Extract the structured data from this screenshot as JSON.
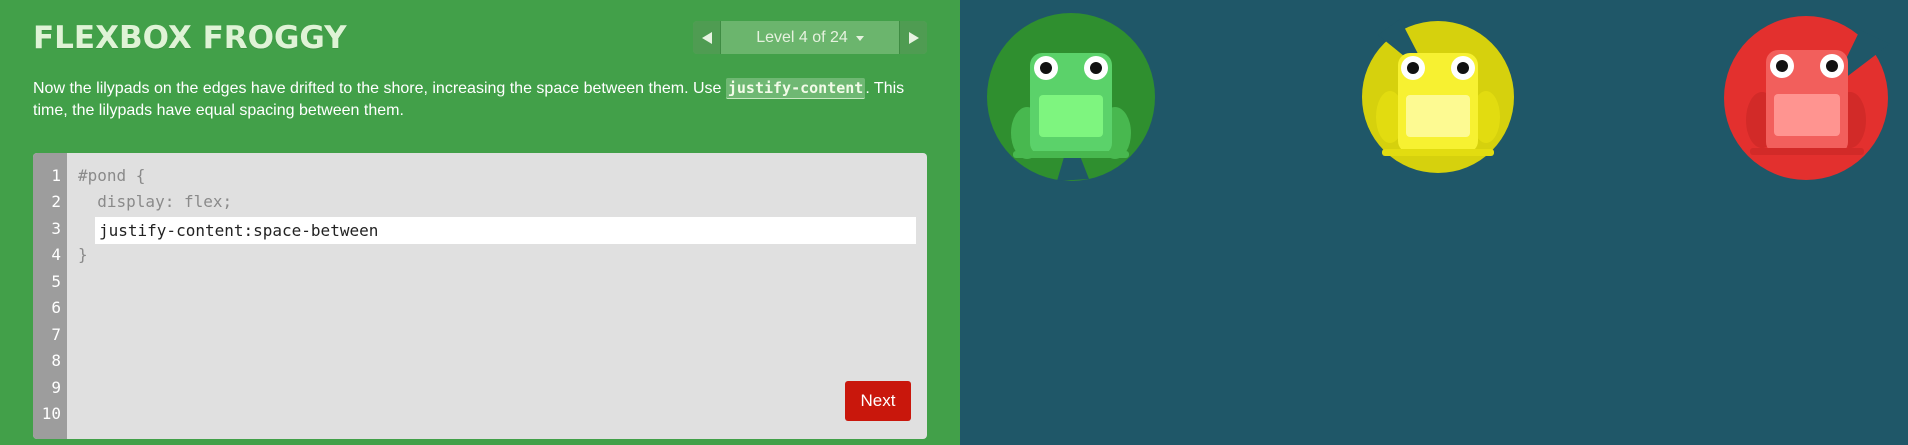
{
  "app": {
    "title": "FLEXBOX FROGGY"
  },
  "level_nav": {
    "label": "Level 4 of 24",
    "current": 4,
    "total": 24
  },
  "instructions": {
    "before": "Now the lilypads on the edges have drifted to the shore, increasing the space between them. Use ",
    "code": "justify-content",
    "after": ". This time, the lilypads have equal spacing between them."
  },
  "editor": {
    "line_numbers": [
      "1",
      "2",
      "3",
      "4",
      "5",
      "6",
      "7",
      "8",
      "9",
      "10"
    ],
    "line1": "#pond {",
    "line2": "  display: flex;",
    "input_value": "justify-content:space-between",
    "line4": "}",
    "next_label": "Next"
  },
  "colors": {
    "sidebar": "#42a049",
    "pond": "#1f5768",
    "next_button": "#c9170c",
    "frog_green": "#5bd26a",
    "frog_yellow": "#f7f131",
    "frog_red": "#f25f5c",
    "pad_green": "#2f8f2f",
    "pad_yellow": "#d6d10d",
    "pad_red": "#e3302e"
  },
  "icons": {
    "prev": "triangle-left-icon",
    "next": "triangle-right-icon",
    "dropdown": "caret-down-icon"
  },
  "pond": {
    "frogs": [
      {
        "color": "green"
      },
      {
        "color": "yellow"
      },
      {
        "color": "red"
      }
    ]
  }
}
